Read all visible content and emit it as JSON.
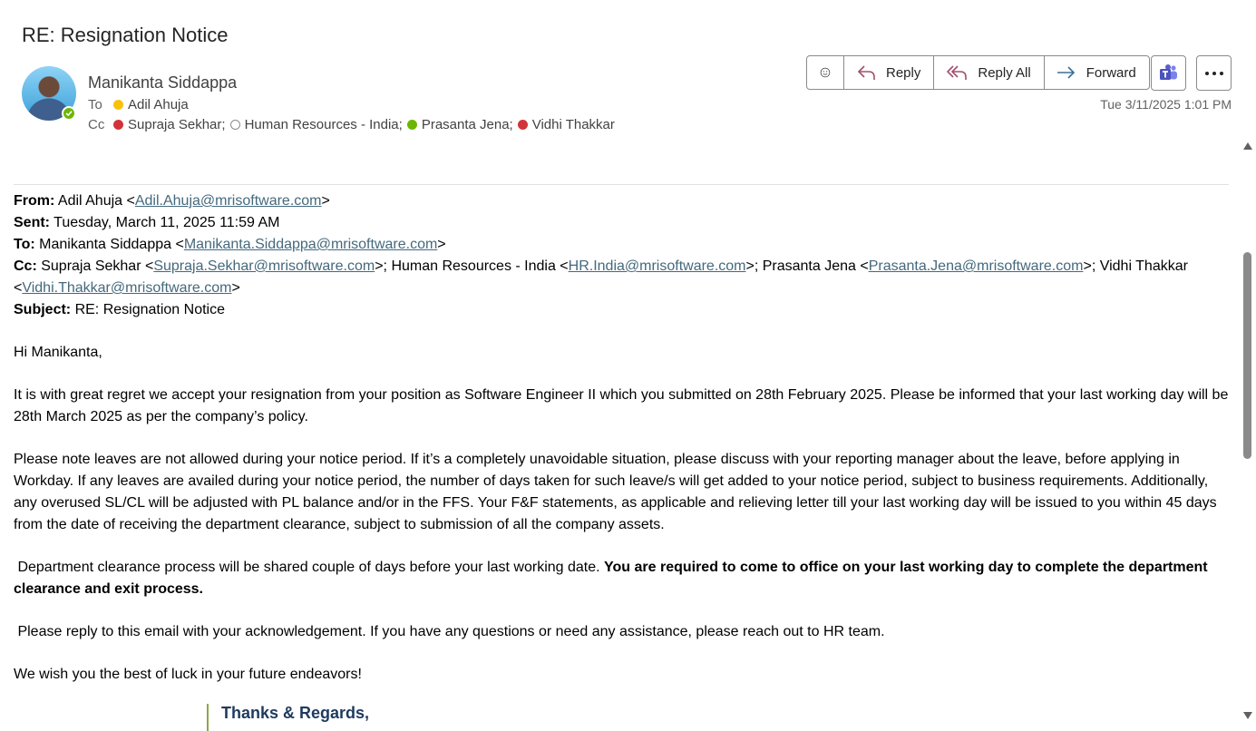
{
  "email": {
    "subject": "RE: Resignation Notice",
    "sender": "Manikanta Siddappa",
    "to_label": "To",
    "cc_label": "Cc",
    "to": [
      {
        "name": "Adil Ahuja",
        "status": "away"
      }
    ],
    "cc": [
      {
        "name": "Supraja Sekhar;",
        "status": "busy"
      },
      {
        "name": "Human Resources - India;",
        "status": "offline"
      },
      {
        "name": "Prasanta Jena;",
        "status": "available"
      },
      {
        "name": "Vidhi Thakkar",
        "status": "busy"
      }
    ],
    "timestamp": "Tue 3/11/2025 1:01 PM"
  },
  "actions": {
    "reply": "Reply",
    "reply_all": "Reply All",
    "forward": "Forward"
  },
  "quoted_header": {
    "from_label": "From:",
    "from_name": " Adil Ahuja <",
    "from_email": "Adil.Ahuja@mrisoftware.com",
    "sent_label": "Sent:",
    "sent_value": " Tuesday, March 11, 2025 11:59 AM",
    "to_label": "To:",
    "to_name": " Manikanta Siddappa <",
    "to_email": "Manikanta.Siddappa@mrisoftware.com",
    "cc_label": "Cc:",
    "cc_1_name": " Supraja Sekhar <",
    "cc_1_email": "Supraja.Sekhar@mrisoftware.com",
    "cc_2_name": ">; Human Resources - India <",
    "cc_2_email": "HR.India@mrisoftware.com",
    "cc_3_name": ">; Prasanta Jena <",
    "cc_3_email": "Prasanta.Jena@mrisoftware.com",
    "cc_4_name": ">; Vidhi Thakkar <",
    "cc_4_email": "Vidhi.Thakkar@mrisoftware.com",
    "close": ">",
    "subject_label": "Subject:",
    "subject_value": " RE: Resignation Notice"
  },
  "body": {
    "greeting": "Hi Manikanta,",
    "p1": "It is with great regret we accept your resignation from your position as Software Engineer II which you submitted on 28th February 2025. Please be informed that your last working day will be 28th March 2025 as per the company’s policy.",
    "p2": "Please note leaves are not allowed during your notice period. If it’s a completely unavoidable situation, please discuss with your reporting manager about the leave, before applying in Workday. If any leaves are availed during your notice period, the number of days taken for such leave/s will get added to your notice period, subject to business requirements. Additionally, any overused SL/CL will be adjusted with PL balance and/or in the FFS. Your F&F statements, as applicable and relieving letter till your last working day will be issued to you within 45 days from the date of receiving the department clearance, subject to submission of all the company assets.",
    "p3_normal": " Department clearance process will be shared couple of days before your last working date. ",
    "p3_bold": "You are required to come to office on your last working day to complete the department clearance and exit process.",
    "p4": " Please reply to this email with your acknowledgement. If you have any questions or need any assistance, please reach out to HR team.",
    "p5": "We wish you the best of luck in your future endeavors!",
    "signature": "Thanks & Regards,"
  },
  "colors": {
    "available": "#6bb700",
    "busy": "#d13438",
    "away": "#f8c10c",
    "link": "#44697d",
    "teams": "#5b5fc7"
  }
}
